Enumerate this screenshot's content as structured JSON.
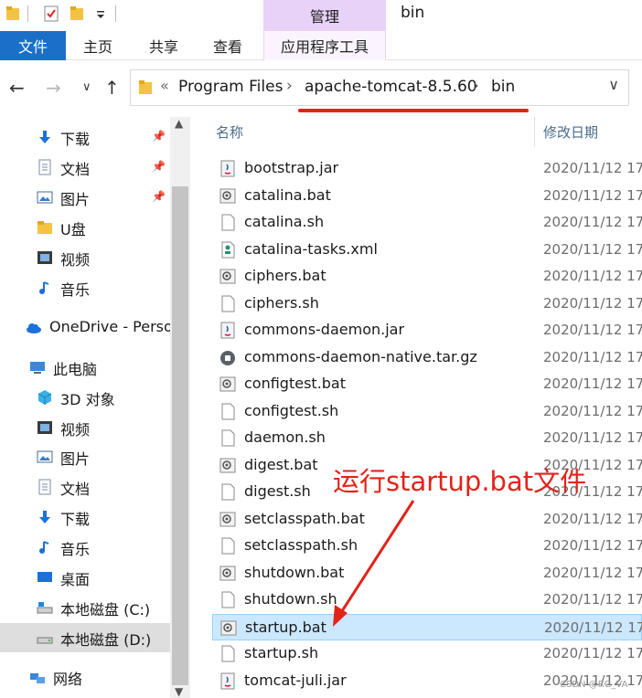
{
  "window": {
    "title": "bin",
    "context_tab_header": "管理"
  },
  "ribbon": {
    "tabs": [
      "文件",
      "主页",
      "共享",
      "查看",
      "应用程序工具"
    ]
  },
  "address": {
    "prefix": "«",
    "crumbs": [
      "Program Files",
      "apache-tomcat-8.5.60",
      "bin"
    ]
  },
  "sidebar": {
    "items": [
      {
        "label": "下载",
        "icon": "download-icon",
        "pinned": true
      },
      {
        "label": "文档",
        "icon": "document-icon",
        "pinned": true
      },
      {
        "label": "图片",
        "icon": "picture-icon",
        "pinned": true
      },
      {
        "label": "U盘",
        "icon": "folder-icon",
        "pinned": false
      },
      {
        "label": "视频",
        "icon": "video-icon",
        "pinned": false
      },
      {
        "label": "音乐",
        "icon": "music-icon",
        "pinned": false
      },
      {
        "label": "OneDrive - Perso",
        "icon": "cloud-icon",
        "pinned": false
      },
      {
        "label": "此电脑",
        "icon": "computer-icon",
        "pinned": false
      },
      {
        "label": "3D 对象",
        "icon": "cube-icon",
        "pinned": false
      },
      {
        "label": "视频",
        "icon": "video-icon",
        "pinned": false
      },
      {
        "label": "图片",
        "icon": "picture-icon",
        "pinned": false
      },
      {
        "label": "文档",
        "icon": "document-icon",
        "pinned": false
      },
      {
        "label": "下载",
        "icon": "download-icon",
        "pinned": false
      },
      {
        "label": "音乐",
        "icon": "music-icon",
        "pinned": false
      },
      {
        "label": "桌面",
        "icon": "desktop-icon",
        "pinned": false
      },
      {
        "label": "本地磁盘 (C:)",
        "icon": "drive-c-icon",
        "pinned": false
      },
      {
        "label": "本地磁盘 (D:)",
        "icon": "drive-icon",
        "pinned": false,
        "selected": true
      },
      {
        "label": "网络",
        "icon": "network-icon",
        "pinned": false
      }
    ]
  },
  "columns": {
    "name": "名称",
    "date": "修改日期"
  },
  "files": [
    {
      "name": "bootstrap.jar",
      "date": "2020/11/12 17",
      "type": "jar"
    },
    {
      "name": "catalina.bat",
      "date": "2020/11/12 17",
      "type": "bat"
    },
    {
      "name": "catalina.sh",
      "date": "2020/11/12 17",
      "type": "sh"
    },
    {
      "name": "catalina-tasks.xml",
      "date": "2020/11/12 17",
      "type": "xml"
    },
    {
      "name": "ciphers.bat",
      "date": "2020/11/12 17",
      "type": "bat"
    },
    {
      "name": "ciphers.sh",
      "date": "2020/11/12 17",
      "type": "sh"
    },
    {
      "name": "commons-daemon.jar",
      "date": "2020/11/12 17",
      "type": "jar"
    },
    {
      "name": "commons-daemon-native.tar.gz",
      "date": "2020/11/12 17",
      "type": "gz"
    },
    {
      "name": "configtest.bat",
      "date": "2020/11/12 17",
      "type": "bat"
    },
    {
      "name": "configtest.sh",
      "date": "2020/11/12 17",
      "type": "sh"
    },
    {
      "name": "daemon.sh",
      "date": "2020/11/12 17",
      "type": "sh"
    },
    {
      "name": "digest.bat",
      "date": "2020/11/12 17",
      "type": "bat"
    },
    {
      "name": "digest.sh",
      "date": "2020/11/12 17",
      "type": "sh"
    },
    {
      "name": "setclasspath.bat",
      "date": "2020/11/12 17",
      "type": "bat"
    },
    {
      "name": "setclasspath.sh",
      "date": "2020/11/12 17",
      "type": "sh"
    },
    {
      "name": "shutdown.bat",
      "date": "2020/11/12 17",
      "type": "bat"
    },
    {
      "name": "shutdown.sh",
      "date": "2020/11/12 17",
      "type": "sh"
    },
    {
      "name": "startup.bat",
      "date": "2020/11/12 17",
      "type": "bat",
      "selected": true
    },
    {
      "name": "startup.sh",
      "date": "2020/11/12 17",
      "type": "sh"
    },
    {
      "name": "tomcat-juli.jar",
      "date": "2020/11/12 17",
      "type": "jar"
    }
  ],
  "annotation": {
    "text": "运行startup.bat文件",
    "color": "#e2231a"
  },
  "watermark": "CSDN @RG_VA",
  "colors": {
    "file_tab": "#1a6fc9",
    "context_tab": "#e8d2f7",
    "selection": "#cce8ff"
  }
}
